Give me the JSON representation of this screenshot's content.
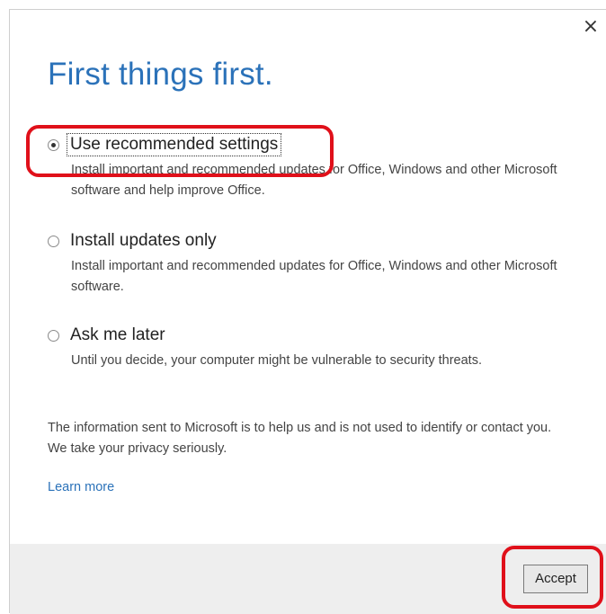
{
  "dialog": {
    "close_symbol": "×",
    "title": "First things first.",
    "options": [
      {
        "label": "Use recommended settings",
        "description": "Install important and recommended updates for Office, Windows and other Microsoft software and help improve Office.",
        "selected": true
      },
      {
        "label": "Install updates only",
        "description": "Install important and recommended updates for Office, Windows and other Microsoft software.",
        "selected": false
      },
      {
        "label": "Ask me later",
        "description": "Until you decide, your computer might be vulnerable to security threats.",
        "selected": false
      }
    ],
    "info_line1": "The information sent to Microsoft is to help us and is not used to identify or contact you.",
    "info_line2": "We take your privacy seriously.",
    "learn_more": "Learn more",
    "accept_label": "Accept"
  },
  "annotations": {
    "color": "#e0101a"
  },
  "colors": {
    "title": "#2b72b9",
    "link": "#2b72b9",
    "footer_bg": "#eeeeee"
  }
}
